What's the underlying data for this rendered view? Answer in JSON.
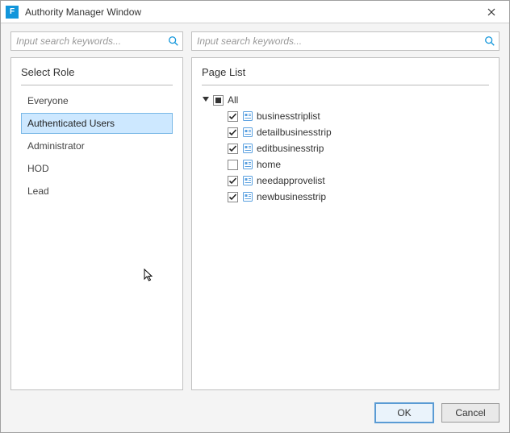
{
  "window": {
    "title": "Authority Manager Window",
    "app_icon_letter": "F"
  },
  "search": {
    "left_placeholder": "Input search keywords...",
    "right_placeholder": "Input search keywords..."
  },
  "left_panel": {
    "title": "Select Role",
    "roles": [
      "Everyone",
      "Authenticated Users",
      "Administrator",
      "HOD",
      "Lead"
    ],
    "selected_index": 1
  },
  "right_panel": {
    "title": "Page List",
    "root": {
      "label": "All",
      "state": "indeterminate",
      "children": [
        {
          "label": "businesstriplist",
          "state": "checked"
        },
        {
          "label": "detailbusinesstrip",
          "state": "checked"
        },
        {
          "label": "editbusinesstrip",
          "state": "checked"
        },
        {
          "label": "home",
          "state": "unchecked"
        },
        {
          "label": "needapprovelist",
          "state": "checked"
        },
        {
          "label": "newbusinesstrip",
          "state": "checked"
        }
      ]
    }
  },
  "footer": {
    "ok": "OK",
    "cancel": "Cancel"
  }
}
